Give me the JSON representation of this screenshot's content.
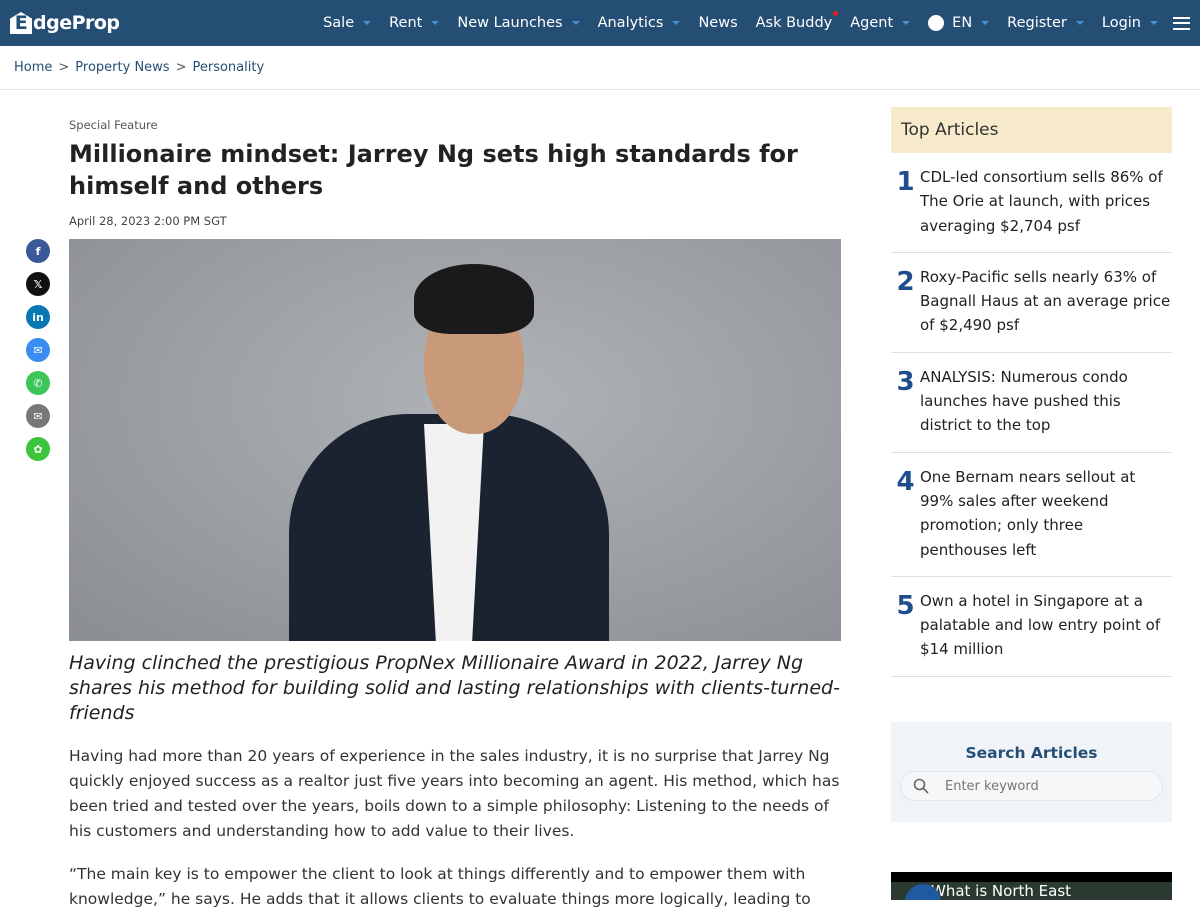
{
  "nav": {
    "logo": "EdgeProp",
    "logo_initial": "E",
    "logo_rest": "dgeProp",
    "items": [
      {
        "label": "Sale",
        "caret": true
      },
      {
        "label": "Rent",
        "caret": true
      },
      {
        "label": "New Launches",
        "caret": true
      },
      {
        "label": "Analytics",
        "caret": true
      },
      {
        "label": "News",
        "caret": false
      },
      {
        "label": "Ask Buddy",
        "caret": false
      },
      {
        "label": "Agent",
        "caret": true
      }
    ],
    "language": "EN",
    "register": "Register",
    "login": "Login"
  },
  "breadcrumb": [
    "Home",
    "Property News",
    "Personality"
  ],
  "article": {
    "kicker": "Special Feature",
    "title": "Millionaire mindset: Jarrey Ng sets high standards for himself and others",
    "date": "April 28, 2023 2:00 PM SGT",
    "lead": "Having clinched the prestigious PropNex Millionaire Award in 2022, Jarrey Ng shares his method for building solid and lasting relationships with clients-turned-friends",
    "paragraphs": [
      "Having had more than 20 years of experience in the sales industry, it is no surprise that Jarrey Ng quickly enjoyed success as a realtor just five years into becoming an agent. His method, which has been tried and tested over the years, boils down to a simple philosophy: Listening to the needs of his customers and understanding how to add value to their lives.",
      "“The main key is to empower the client to look at things differently and to empower them with knowledge,” he says. He adds that it allows clients to evaluate things more logically, leading to"
    ]
  },
  "share": [
    "facebook",
    "x",
    "linkedin",
    "messenger",
    "whatsapp",
    "email",
    "wechat"
  ],
  "share_labels": [
    "f",
    "𝕏",
    "in",
    "✉",
    "✆",
    "✉",
    "✿"
  ],
  "top_articles": {
    "heading": "Top Articles",
    "items": [
      {
        "num": "1",
        "title": "CDL-led consortium sells 86% of The Orie at launch, with prices averaging $2,704 psf"
      },
      {
        "num": "2",
        "title": "Roxy-Pacific sells nearly 63% of Bagnall Haus at an average price of $2,490 psf"
      },
      {
        "num": "3",
        "title": "ANALYSIS: Numerous condo launches have pushed this district to the top"
      },
      {
        "num": "4",
        "title": "One Bernam nears sellout at 99% sales after weekend promotion; only three penthouses left"
      },
      {
        "num": "5",
        "title": "Own a hotel in Singapore at a palatable and low entry point of $14 million"
      }
    ]
  },
  "search": {
    "heading": "Search Articles",
    "placeholder": "Enter keyword"
  },
  "video": {
    "title": "What is North East"
  }
}
